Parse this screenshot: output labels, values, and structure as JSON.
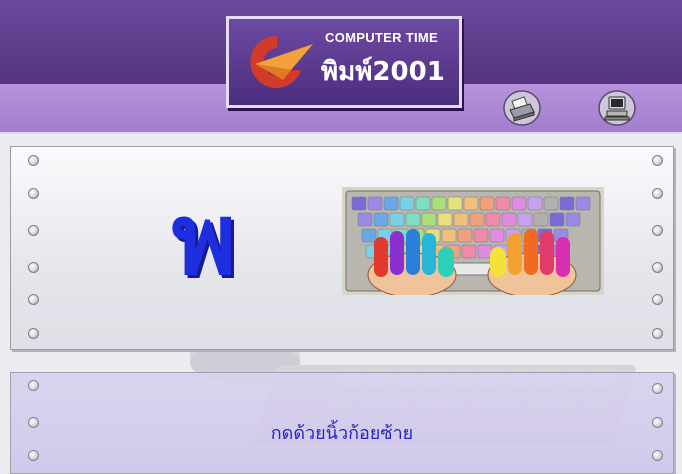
{
  "header": {
    "logo_title": "COMPUTER TIME",
    "logo_subtitle": "พิมพ์2001"
  },
  "toolbar": {
    "buttons": [
      {
        "name": "printer-button",
        "icon": "printer-icon"
      },
      {
        "name": "computer-button",
        "icon": "computer-icon"
      }
    ]
  },
  "lesson": {
    "current_letter": "พ",
    "letter_color": "#1818c8",
    "keyboard_illustration": "colored-keyboard-with-hands",
    "instruction": "กดด้วยนิ้วก้อยซ้าย",
    "instruction_color": "#1414c8"
  },
  "colors": {
    "header_bg": "#5f3f8f",
    "band_bg": "#a985d4",
    "panel_bg": "#e8e8ee",
    "bottom_panel_bg": "#d4ccec"
  }
}
